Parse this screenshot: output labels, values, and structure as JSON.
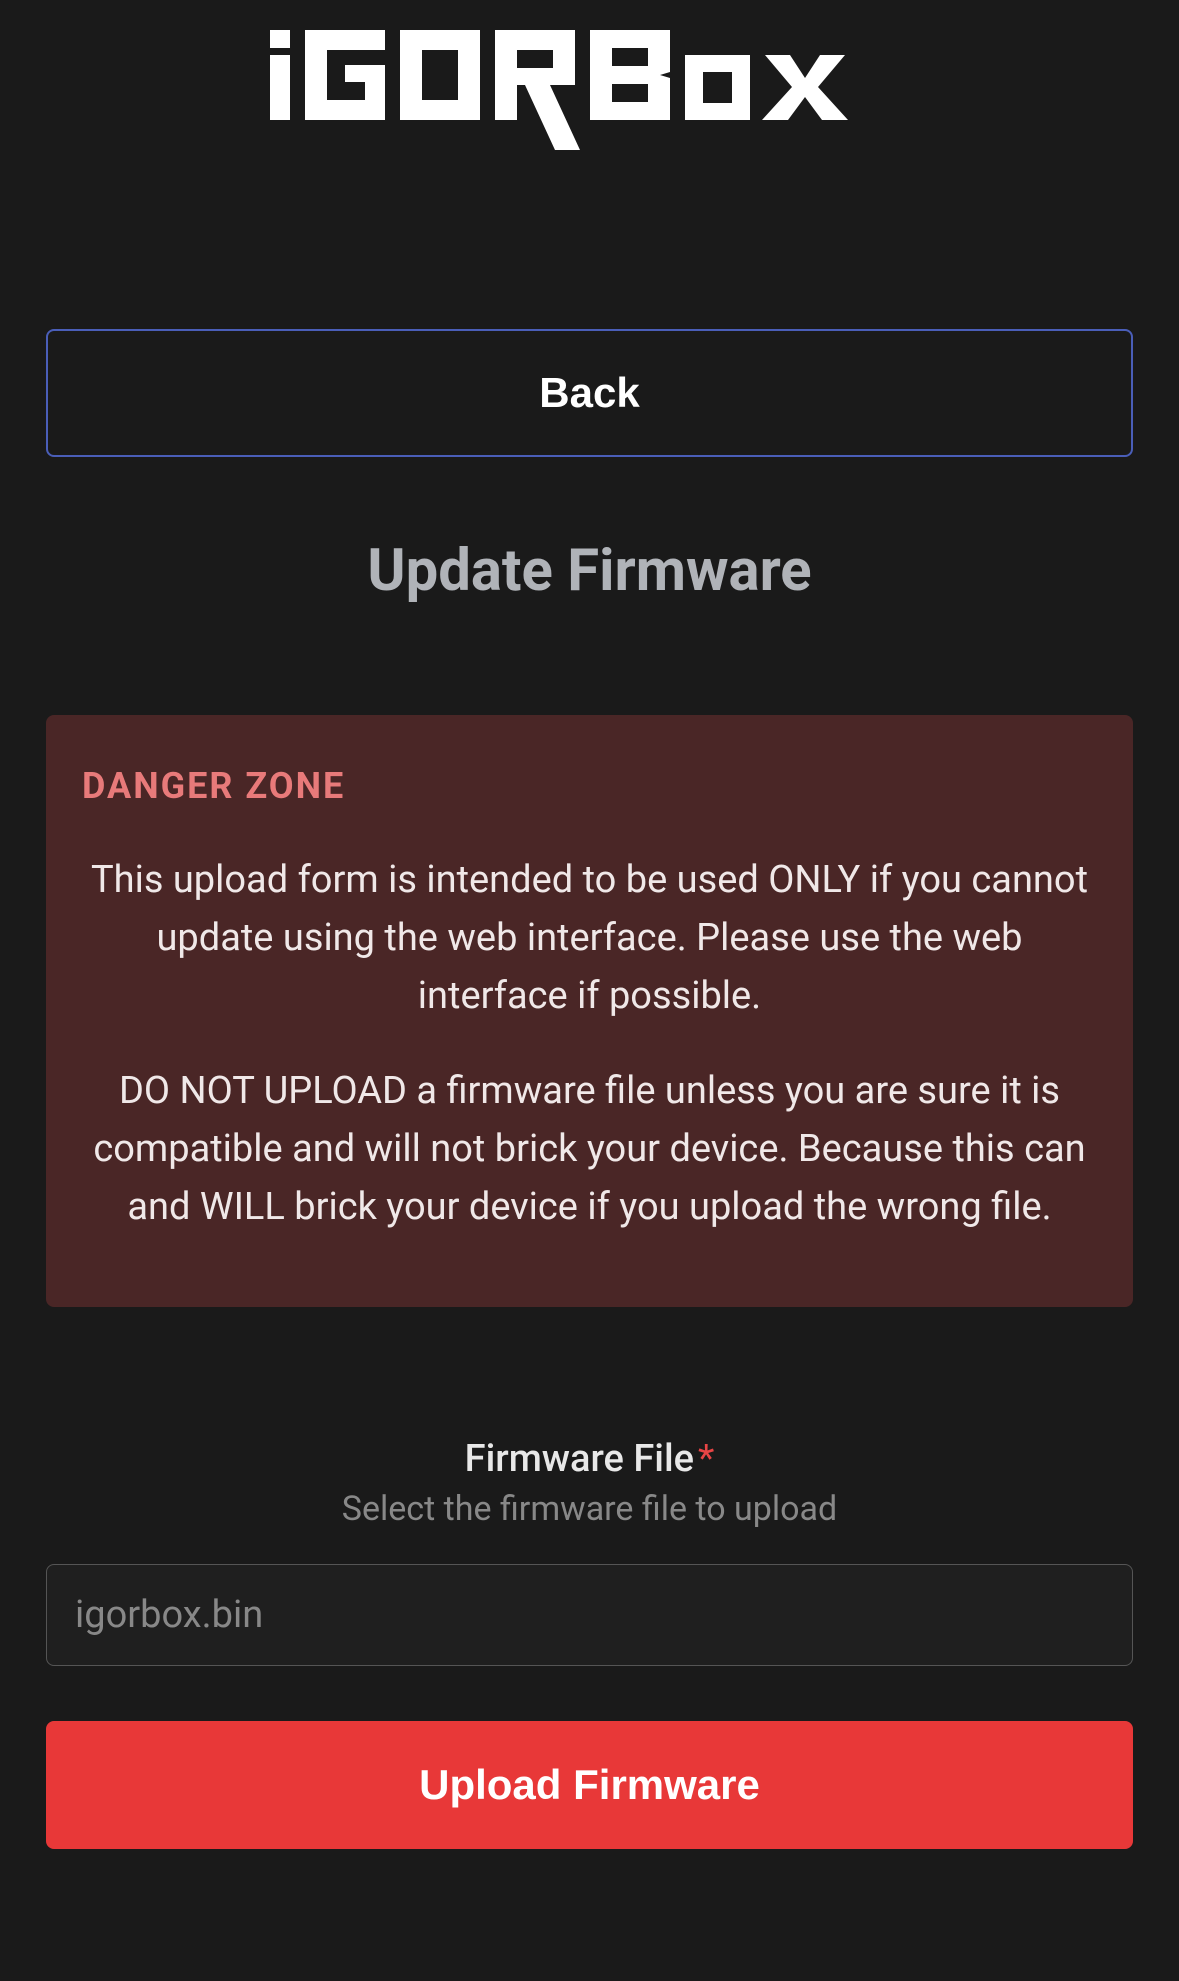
{
  "logo": {
    "text": "iGORBox"
  },
  "back_button": {
    "label": "Back"
  },
  "page_title": "Update Firmware",
  "danger": {
    "title": "DANGER ZONE",
    "paragraph1": "This upload form is intended to be used ONLY if you cannot update using the web interface. Please use the web interface if possible.",
    "paragraph2": "DO NOT UPLOAD a firmware file unless you are sure it is compatible and will not brick your device. Because this can and WILL brick your device if you upload the wrong file."
  },
  "form": {
    "label": "Firmware File",
    "required_mark": "*",
    "helper": "Select the firmware file to upload",
    "placeholder": "igorbox.bin",
    "submit_label": "Upload Firmware"
  }
}
